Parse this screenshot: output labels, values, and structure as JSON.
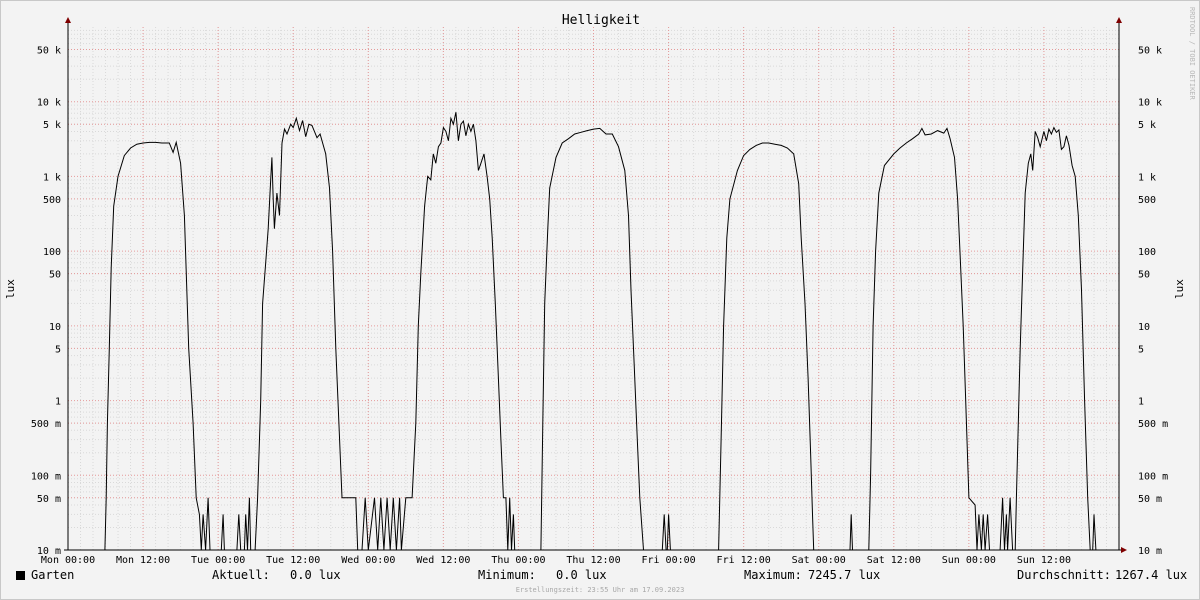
{
  "chart_data": {
    "type": "line",
    "title": "Helligkeit",
    "ylabel": "lux",
    "yscale": "log",
    "ylim": [
      0.01,
      100000
    ],
    "y_ticks": [
      {
        "v": 0.01,
        "label": "10 m"
      },
      {
        "v": 0.05,
        "label": "50 m"
      },
      {
        "v": 0.1,
        "label": "100 m"
      },
      {
        "v": 0.5,
        "label": "500 m"
      },
      {
        "v": 1,
        "label": "1"
      },
      {
        "v": 5,
        "label": "5"
      },
      {
        "v": 10,
        "label": "10"
      },
      {
        "v": 50,
        "label": "50"
      },
      {
        "v": 100,
        "label": "100"
      },
      {
        "v": 500,
        "label": "500"
      },
      {
        "v": 1000,
        "label": "1 k"
      },
      {
        "v": 5000,
        "label": "5 k"
      },
      {
        "v": 10000,
        "label": "10 k"
      },
      {
        "v": 50000,
        "label": "50 k"
      }
    ],
    "x_unit": "hours since Mon 00:00",
    "xlim": [
      0,
      168
    ],
    "x_ticks": [
      {
        "h": 0,
        "label": "Mon 00:00"
      },
      {
        "h": 12,
        "label": "Mon 12:00"
      },
      {
        "h": 24,
        "label": "Tue 00:00"
      },
      {
        "h": 36,
        "label": "Tue 12:00"
      },
      {
        "h": 48,
        "label": "Wed 00:00"
      },
      {
        "h": 60,
        "label": "Wed 12:00"
      },
      {
        "h": 72,
        "label": "Thu 00:00"
      },
      {
        "h": 84,
        "label": "Thu 12:00"
      },
      {
        "h": 96,
        "label": "Fri 00:00"
      },
      {
        "h": 108,
        "label": "Fri 12:00"
      },
      {
        "h": 120,
        "label": "Sat 00:00"
      },
      {
        "h": 132,
        "label": "Sat 12:00"
      },
      {
        "h": 144,
        "label": "Sun 00:00"
      },
      {
        "h": 156,
        "label": "Sun 12:00"
      }
    ],
    "grid": true,
    "series": [
      {
        "name": "Garten",
        "color": "#000000",
        "points": [
          [
            0,
            0.01
          ],
          [
            5.9,
            0.01
          ],
          [
            6.1,
            0.05
          ],
          [
            6.3,
            0.5
          ],
          [
            6.6,
            5
          ],
          [
            6.9,
            60
          ],
          [
            7.3,
            400
          ],
          [
            8,
            1000
          ],
          [
            9,
            1900
          ],
          [
            10,
            2400
          ],
          [
            11,
            2700
          ],
          [
            12,
            2800
          ],
          [
            13,
            2850
          ],
          [
            14,
            2850
          ],
          [
            15,
            2800
          ],
          [
            16.2,
            2800
          ],
          [
            16.8,
            2100
          ],
          [
            17.3,
            2850
          ],
          [
            18,
            1500
          ],
          [
            18.6,
            300
          ],
          [
            19.3,
            5
          ],
          [
            20,
            0.5
          ],
          [
            20.5,
            0.05
          ],
          [
            21,
            0.03
          ],
          [
            21.3,
            0.01
          ],
          [
            21.6,
            0.03
          ],
          [
            22,
            0.01
          ],
          [
            22.4,
            0.05
          ],
          [
            22.7,
            0.01
          ],
          [
            24.5,
            0.01
          ],
          [
            24.8,
            0.03
          ],
          [
            25,
            0.01
          ],
          [
            27,
            0.01
          ],
          [
            27.3,
            0.03
          ],
          [
            27.6,
            0.01
          ],
          [
            28.2,
            0.01
          ],
          [
            28.4,
            0.03
          ],
          [
            28.7,
            0.01
          ],
          [
            29,
            0.05
          ],
          [
            29.2,
            0.01
          ],
          [
            29.9,
            0.01
          ],
          [
            30.3,
            0.05
          ],
          [
            30.8,
            1
          ],
          [
            31.1,
            20
          ],
          [
            31.6,
            70
          ],
          [
            32,
            200
          ],
          [
            32.4,
            900
          ],
          [
            32.6,
            1800
          ],
          [
            32.8,
            500
          ],
          [
            33,
            200
          ],
          [
            33.4,
            600
          ],
          [
            33.8,
            300
          ],
          [
            34.2,
            2800
          ],
          [
            34.6,
            4300
          ],
          [
            35,
            3700
          ],
          [
            35.6,
            5000
          ],
          [
            36,
            4500
          ],
          [
            36.5,
            6000
          ],
          [
            37,
            4100
          ],
          [
            37.5,
            5600
          ],
          [
            38,
            3400
          ],
          [
            38.5,
            5000
          ],
          [
            39,
            4800
          ],
          [
            39.8,
            3300
          ],
          [
            40.3,
            3700
          ],
          [
            41.2,
            2000
          ],
          [
            41.8,
            700
          ],
          [
            42.3,
            100
          ],
          [
            42.8,
            5
          ],
          [
            43.3,
            0.5
          ],
          [
            43.8,
            0.05
          ],
          [
            45,
            0.05
          ],
          [
            46,
            0.05
          ],
          [
            46.3,
            0.01
          ],
          [
            47,
            0.01
          ],
          [
            47.5,
            0.05
          ],
          [
            48,
            0.01
          ],
          [
            49,
            0.05
          ],
          [
            49.5,
            0.01
          ],
          [
            50,
            0.05
          ],
          [
            50.5,
            0.01
          ],
          [
            51,
            0.05
          ],
          [
            51.5,
            0.01
          ],
          [
            52,
            0.05
          ],
          [
            52.5,
            0.01
          ],
          [
            53,
            0.05
          ],
          [
            53.3,
            0.01
          ],
          [
            54,
            0.05
          ],
          [
            55,
            0.05
          ],
          [
            55.6,
            0.5
          ],
          [
            56,
            10
          ],
          [
            56.4,
            50
          ],
          [
            57,
            400
          ],
          [
            57.5,
            1000
          ],
          [
            58,
            900
          ],
          [
            58.4,
            2000
          ],
          [
            58.8,
            1500
          ],
          [
            59.2,
            2500
          ],
          [
            59.6,
            2800
          ],
          [
            60,
            4500
          ],
          [
            60.4,
            4000
          ],
          [
            60.8,
            3000
          ],
          [
            61.2,
            6000
          ],
          [
            61.6,
            5000
          ],
          [
            62,
            7245.7
          ],
          [
            62.4,
            3000
          ],
          [
            62.8,
            5000
          ],
          [
            63.2,
            5500
          ],
          [
            63.6,
            3500
          ],
          [
            64,
            5000
          ],
          [
            64.4,
            4000
          ],
          [
            64.8,
            5000
          ],
          [
            65.2,
            3000
          ],
          [
            65.6,
            1200
          ],
          [
            66,
            1500
          ],
          [
            66.5,
            2000
          ],
          [
            67,
            1000
          ],
          [
            67.4,
            500
          ],
          [
            67.8,
            150
          ],
          [
            68.3,
            20
          ],
          [
            68.8,
            2
          ],
          [
            69.2,
            0.3
          ],
          [
            69.6,
            0.05
          ],
          [
            70,
            0.05
          ],
          [
            70.3,
            0.01
          ],
          [
            70.6,
            0.05
          ],
          [
            70.9,
            0.01
          ],
          [
            71.2,
            0.03
          ],
          [
            71.4,
            0.01
          ],
          [
            72,
            0.01
          ],
          [
            75.6,
            0.01
          ],
          [
            75.9,
            0.5
          ],
          [
            76.2,
            20
          ],
          [
            76.7,
            200
          ],
          [
            77,
            700
          ],
          [
            78,
            1800
          ],
          [
            79,
            2800
          ],
          [
            80,
            3200
          ],
          [
            81,
            3700
          ],
          [
            82,
            3900
          ],
          [
            83,
            4100
          ],
          [
            84,
            4300
          ],
          [
            85,
            4400
          ],
          [
            86,
            3700
          ],
          [
            87,
            3700
          ],
          [
            88,
            2500
          ],
          [
            89,
            1200
          ],
          [
            89.6,
            300
          ],
          [
            90,
            30
          ],
          [
            90.5,
            3
          ],
          [
            91,
            0.3
          ],
          [
            91.4,
            0.05
          ],
          [
            92,
            0.01
          ],
          [
            95,
            0.01
          ],
          [
            95.3,
            0.03
          ],
          [
            95.6,
            0.01
          ],
          [
            95.8,
            0.01
          ],
          [
            96,
            0.03
          ],
          [
            96.3,
            0.01
          ],
          [
            104,
            0.01
          ],
          [
            104.4,
            0.3
          ],
          [
            104.8,
            10
          ],
          [
            105.3,
            150
          ],
          [
            105.8,
            500
          ],
          [
            107,
            1200
          ],
          [
            108,
            1900
          ],
          [
            109,
            2300
          ],
          [
            110,
            2600
          ],
          [
            111,
            2800
          ],
          [
            112,
            2800
          ],
          [
            113,
            2700
          ],
          [
            114,
            2600
          ],
          [
            115,
            2400
          ],
          [
            116,
            2000
          ],
          [
            116.8,
            800
          ],
          [
            117.2,
            150
          ],
          [
            117.8,
            20
          ],
          [
            118.3,
            2
          ],
          [
            118.7,
            0.2
          ],
          [
            119,
            0.03
          ],
          [
            119.2,
            0.01
          ],
          [
            125,
            0.01
          ],
          [
            125.2,
            0.03
          ],
          [
            125.4,
            0.01
          ],
          [
            128,
            0.01
          ],
          [
            128.3,
            0.1
          ],
          [
            128.7,
            10
          ],
          [
            129.1,
            100
          ],
          [
            129.6,
            600
          ],
          [
            130.5,
            1400
          ],
          [
            132,
            2000
          ],
          [
            133,
            2400
          ],
          [
            134,
            2800
          ],
          [
            135,
            3200
          ],
          [
            136,
            3700
          ],
          [
            136.5,
            4400
          ],
          [
            137,
            3600
          ],
          [
            138,
            3700
          ],
          [
            139,
            4100
          ],
          [
            140,
            3800
          ],
          [
            140.5,
            4400
          ],
          [
            141,
            3200
          ],
          [
            141.7,
            1800
          ],
          [
            142.2,
            500
          ],
          [
            142.6,
            90
          ],
          [
            143.1,
            10
          ],
          [
            143.5,
            1
          ],
          [
            144,
            0.05
          ],
          [
            145,
            0.04
          ],
          [
            145.3,
            0.01
          ],
          [
            145.6,
            0.03
          ],
          [
            146,
            0.01
          ],
          [
            146.3,
            0.03
          ],
          [
            146.6,
            0.01
          ],
          [
            147,
            0.03
          ],
          [
            147.3,
            0.01
          ],
          [
            149,
            0.01
          ],
          [
            149.4,
            0.05
          ],
          [
            149.7,
            0.01
          ],
          [
            150,
            0.03
          ],
          [
            150.2,
            0.01
          ],
          [
            150.6,
            0.05
          ],
          [
            151,
            0.01
          ],
          [
            151.4,
            0.01
          ],
          [
            151.6,
            0.05
          ],
          [
            152.2,
            5
          ],
          [
            152.7,
            100
          ],
          [
            153,
            600
          ],
          [
            153.5,
            1500
          ],
          [
            153.9,
            2000
          ],
          [
            154.2,
            1200
          ],
          [
            154.6,
            4000
          ],
          [
            155,
            3300
          ],
          [
            155.4,
            2500
          ],
          [
            156,
            4000
          ],
          [
            156.4,
            3000
          ],
          [
            156.8,
            4300
          ],
          [
            157.2,
            3700
          ],
          [
            157.6,
            4500
          ],
          [
            158,
            3900
          ],
          [
            158.4,
            4200
          ],
          [
            158.8,
            2300
          ],
          [
            159.2,
            2500
          ],
          [
            159.6,
            3500
          ],
          [
            160,
            2600
          ],
          [
            160.5,
            1400
          ],
          [
            161,
            1000
          ],
          [
            161.5,
            300
          ],
          [
            162,
            30
          ],
          [
            162.5,
            1
          ],
          [
            163,
            0.05
          ],
          [
            163.4,
            0.01
          ],
          [
            163.8,
            0.01
          ],
          [
            164,
            0.03
          ],
          [
            164.3,
            0.01
          ],
          [
            165,
            0.01
          ],
          [
            165.5,
            0.01
          ],
          [
            166,
            0.01
          ]
        ]
      }
    ],
    "legend": {
      "series_name": "Garten",
      "current_label": "Aktuell:",
      "current_value": "0.0 lux",
      "min_label": "Minimum:",
      "min_value": "0.0 lux",
      "max_label": "Maximum:",
      "max_value": "7245.7 lux",
      "avg_label": "Durchschnitt:",
      "avg_value": "1267.4 lux"
    }
  },
  "watermark": "RRDTOOL / TOBI OETIKER",
  "footer": "Erstellungszeit: 23:55 Uhr am 17.09.2023"
}
